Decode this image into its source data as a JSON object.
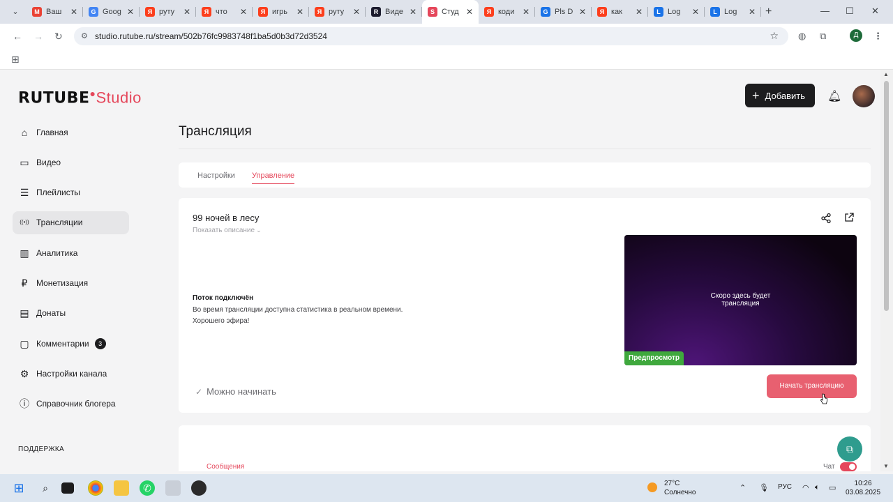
{
  "browser": {
    "tabs": [
      {
        "title": "Ваш",
        "icon": "gmail-icon",
        "color": "#ea4335",
        "glyph": "M"
      },
      {
        "title": "Goog",
        "icon": "google-icon",
        "color": "#4285f4",
        "glyph": "G"
      },
      {
        "title": "руту",
        "icon": "yandex-icon",
        "color": "#fc3f1d",
        "glyph": "Я"
      },
      {
        "title": "что",
        "icon": "yandex-icon",
        "color": "#fc3f1d",
        "glyph": "Я"
      },
      {
        "title": "игрь",
        "icon": "yandex-icon",
        "color": "#fc3f1d",
        "glyph": "Я"
      },
      {
        "title": "руту",
        "icon": "yandex-icon",
        "color": "#fc3f1d",
        "glyph": "Я"
      },
      {
        "title": "Виде",
        "icon": "rutube-icon",
        "color": "#1c1c2e",
        "glyph": "R"
      },
      {
        "title": "Студ",
        "icon": "rutube-studio-icon",
        "color": "#e5475b",
        "glyph": "S",
        "active": true
      },
      {
        "title": "коди",
        "icon": "yandex-icon",
        "color": "#fc3f1d",
        "glyph": "Я"
      },
      {
        "title": "Pls D",
        "icon": "grammarly-icon",
        "color": "#1a73e8",
        "glyph": "G"
      },
      {
        "title": "как",
        "icon": "yandex-icon",
        "color": "#fc3f1d",
        "glyph": "Я"
      },
      {
        "title": "Log",
        "icon": "doc-icon",
        "color": "#1a73e8",
        "glyph": "L"
      },
      {
        "title": "Log",
        "icon": "doc-icon",
        "color": "#1a73e8",
        "glyph": "L"
      }
    ],
    "url": "studio.rutube.ru/stream/502b76fc9983748f1ba5d0b3d72d3524",
    "profile_initial": "Д"
  },
  "header": {
    "logo_main": "RUTUBE",
    "logo_studio": "Studio",
    "add_button": "Добавить"
  },
  "sidebar": {
    "items": [
      {
        "label": "Главная",
        "icon": "home-icon",
        "glyph": "⌂"
      },
      {
        "label": "Видео",
        "icon": "video-icon",
        "glyph": "▭"
      },
      {
        "label": "Плейлисты",
        "icon": "playlist-icon",
        "glyph": "☰"
      },
      {
        "label": "Трансляции",
        "icon": "broadcast-icon",
        "glyph": "((•))",
        "active": true
      },
      {
        "label": "Аналитика",
        "icon": "analytics-icon",
        "glyph": "▥"
      },
      {
        "label": "Монетизация",
        "icon": "ruble-icon",
        "glyph": "₽"
      },
      {
        "label": "Донаты",
        "icon": "donate-icon",
        "glyph": "▤"
      },
      {
        "label": "Комментарии",
        "icon": "comment-icon",
        "glyph": "▢",
        "badge": "3"
      },
      {
        "label": "Настройки канала",
        "icon": "gear-icon",
        "glyph": "⚙"
      },
      {
        "label": "Справочник блогера",
        "icon": "info-icon",
        "glyph": "ⓘ"
      }
    ],
    "support_label": "ПОДДЕРЖКА"
  },
  "main": {
    "page_title": "Трансляция",
    "tabs": [
      {
        "label": "Настройки"
      },
      {
        "label": "Управление",
        "active": true
      }
    ],
    "stream": {
      "title": "99 ночей в лесу",
      "show_description": "Показать описание",
      "status_title": "Поток подключён",
      "status_line1": "Во время трансляции доступна статистика в реальном времени.",
      "status_line2": "Хорошего эфира!",
      "preview_text_line1": "Скоро здесь будет",
      "preview_text_line2": "трансляция",
      "preview_badge": "Предпросмотр",
      "ready_text": "Можно начинать",
      "start_button": "Начать трансляцию"
    },
    "bottom": {
      "messages_label": "Сообщения",
      "chat_label": "Чат"
    }
  },
  "taskbar": {
    "weather_temp": "27°C",
    "weather_desc": "Солнечно",
    "lang": "РУС",
    "time": "10:26",
    "date": "03.08.2025"
  },
  "colors": {
    "accent": "#e5475b",
    "start_button": "#e86070",
    "preview_badge": "#3fa83d",
    "help_fab": "#2f9c8e"
  }
}
